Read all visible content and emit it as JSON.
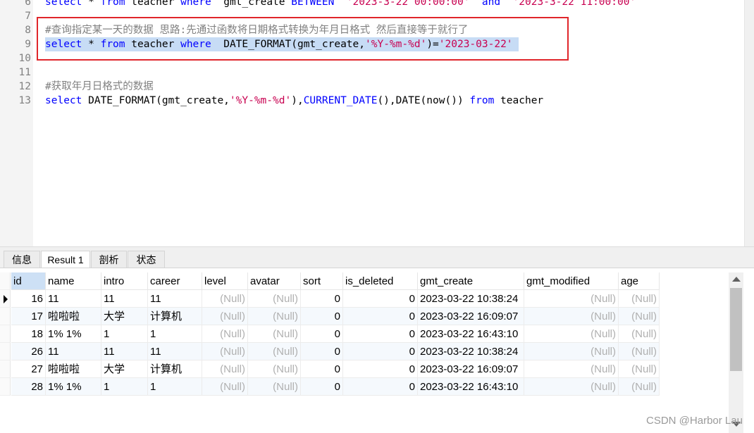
{
  "editor": {
    "lines": [
      {
        "num": "6",
        "parts": [
          {
            "t": "select",
            "c": "kw"
          },
          {
            "t": " * ",
            "c": "pl"
          },
          {
            "t": "from",
            "c": "kw"
          },
          {
            "t": " teacher ",
            "c": "pl"
          },
          {
            "t": "where",
            "c": "kw"
          },
          {
            "t": "  gmt_create ",
            "c": "pl"
          },
          {
            "t": "BETWEEN",
            "c": "kw"
          },
          {
            "t": "  ",
            "c": "pl"
          },
          {
            "t": "'2023-3-22 00:00:00'",
            "c": "str"
          },
          {
            "t": "  ",
            "c": "pl"
          },
          {
            "t": "and",
            "c": "kw"
          },
          {
            "t": "  ",
            "c": "pl"
          },
          {
            "t": "'2023-3-22 11:00:00'",
            "c": "str"
          }
        ]
      },
      {
        "num": "7",
        "parts": []
      },
      {
        "num": "8",
        "parts": [
          {
            "t": "#查询指定某一天的数据 思路:先通过函数将日期格式转换为年月日格式 然后直接等于就行了",
            "c": "cm"
          }
        ]
      },
      {
        "num": "9",
        "selected": true,
        "parts": [
          {
            "t": "select",
            "c": "kw"
          },
          {
            "t": " * ",
            "c": "pl"
          },
          {
            "t": "from",
            "c": "kw"
          },
          {
            "t": " teacher ",
            "c": "pl"
          },
          {
            "t": "where",
            "c": "kw"
          },
          {
            "t": "  DATE_FORMAT(gmt_create,",
            "c": "pl"
          },
          {
            "t": "'%Y-%m-%d'",
            "c": "str"
          },
          {
            "t": ")=",
            "c": "pl"
          },
          {
            "t": "'2023-03-22'",
            "c": "str"
          },
          {
            "t": " ",
            "c": "pl"
          }
        ]
      },
      {
        "num": "10",
        "parts": []
      },
      {
        "num": "11",
        "parts": []
      },
      {
        "num": "12",
        "parts": [
          {
            "t": "#获取年月日格式的数据",
            "c": "cm"
          }
        ]
      },
      {
        "num": "13",
        "parts": [
          {
            "t": "select",
            "c": "kw"
          },
          {
            "t": " DATE_FORMAT(gmt_create,",
            "c": "pl"
          },
          {
            "t": "'%Y-%m-%d'",
            "c": "str"
          },
          {
            "t": "),",
            "c": "pl"
          },
          {
            "t": "CURRENT_DATE",
            "c": "fn"
          },
          {
            "t": "(),DATE(now()) ",
            "c": "pl"
          },
          {
            "t": "from",
            "c": "kw"
          },
          {
            "t": " teacher",
            "c": "pl"
          }
        ]
      }
    ]
  },
  "tabs": [
    {
      "label": "信息",
      "active": false
    },
    {
      "label": "Result 1",
      "active": true
    },
    {
      "label": "剖析",
      "active": false
    },
    {
      "label": "状态",
      "active": false
    }
  ],
  "grid": {
    "columns": [
      "id",
      "name",
      "intro",
      "career",
      "level",
      "avatar",
      "sort",
      "is_deleted",
      "gmt_create",
      "gmt_modified",
      "age"
    ],
    "rows": [
      [
        "16",
        "11",
        "11",
        "11",
        "(Null)",
        "(Null)",
        "0",
        "0",
        "2023-03-22 10:38:24",
        "(Null)",
        "(Null)"
      ],
      [
        "17",
        "啦啦啦",
        "大学",
        "计算机",
        "(Null)",
        "(Null)",
        "0",
        "0",
        "2023-03-22 16:09:07",
        "(Null)",
        "(Null)"
      ],
      [
        "18",
        "1% 1%",
        "1",
        "1",
        "(Null)",
        "(Null)",
        "0",
        "0",
        "2023-03-22 16:43:10",
        "(Null)",
        "(Null)"
      ],
      [
        "26",
        "11",
        "11",
        "11",
        "(Null)",
        "(Null)",
        "0",
        "0",
        "2023-03-22 10:38:24",
        "(Null)",
        "(Null)"
      ],
      [
        "27",
        "啦啦啦",
        "大学",
        "计算机",
        "(Null)",
        "(Null)",
        "0",
        "0",
        "2023-03-22 16:09:07",
        "(Null)",
        "(Null)"
      ],
      [
        "28",
        "1% 1%",
        "1",
        "1",
        "(Null)",
        "(Null)",
        "0",
        "0",
        "2023-03-22 16:43:10",
        "(Null)",
        "(Null)"
      ]
    ]
  },
  "watermark": "CSDN @Harbor Lau"
}
